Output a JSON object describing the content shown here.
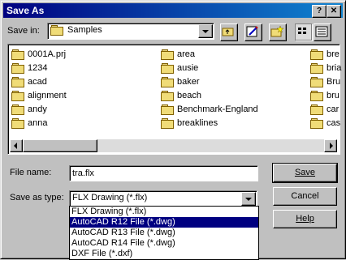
{
  "window": {
    "title": "Save As",
    "help_glyph": "?",
    "close_glyph": "✕"
  },
  "save_in": {
    "label": "Save in:",
    "value": "Samples"
  },
  "files": {
    "col1": [
      "0001A.prj",
      "1234",
      "acad",
      "alignment",
      "andy",
      "anna"
    ],
    "col2": [
      "area",
      "ausie",
      "baker",
      "beach",
      "Benchmark-England",
      "breaklines"
    ],
    "col3": [
      "bre",
      "bria",
      "Bru",
      "bru",
      "car",
      "cas"
    ]
  },
  "file_name": {
    "label": "File name:",
    "value": "tra.flx"
  },
  "save_as_type": {
    "label": "Save as type:",
    "value": "FLX Drawing (*.flx)",
    "options": [
      "FLX Drawing (*.flx)",
      "AutoCAD R12 File (*.dwg)",
      "AutoCAD R13 File (*.dwg)",
      "AutoCAD R14 File (*.dwg)",
      "DXF File (*.dxf)"
    ],
    "selected_index": 1
  },
  "buttons": {
    "save": "Save",
    "cancel": "Cancel",
    "help": "Help"
  },
  "icons": [
    "folder-icon",
    "up-folder-icon",
    "create-folder-icon",
    "new-folder-icon",
    "list-view-icon",
    "details-view-icon"
  ]
}
